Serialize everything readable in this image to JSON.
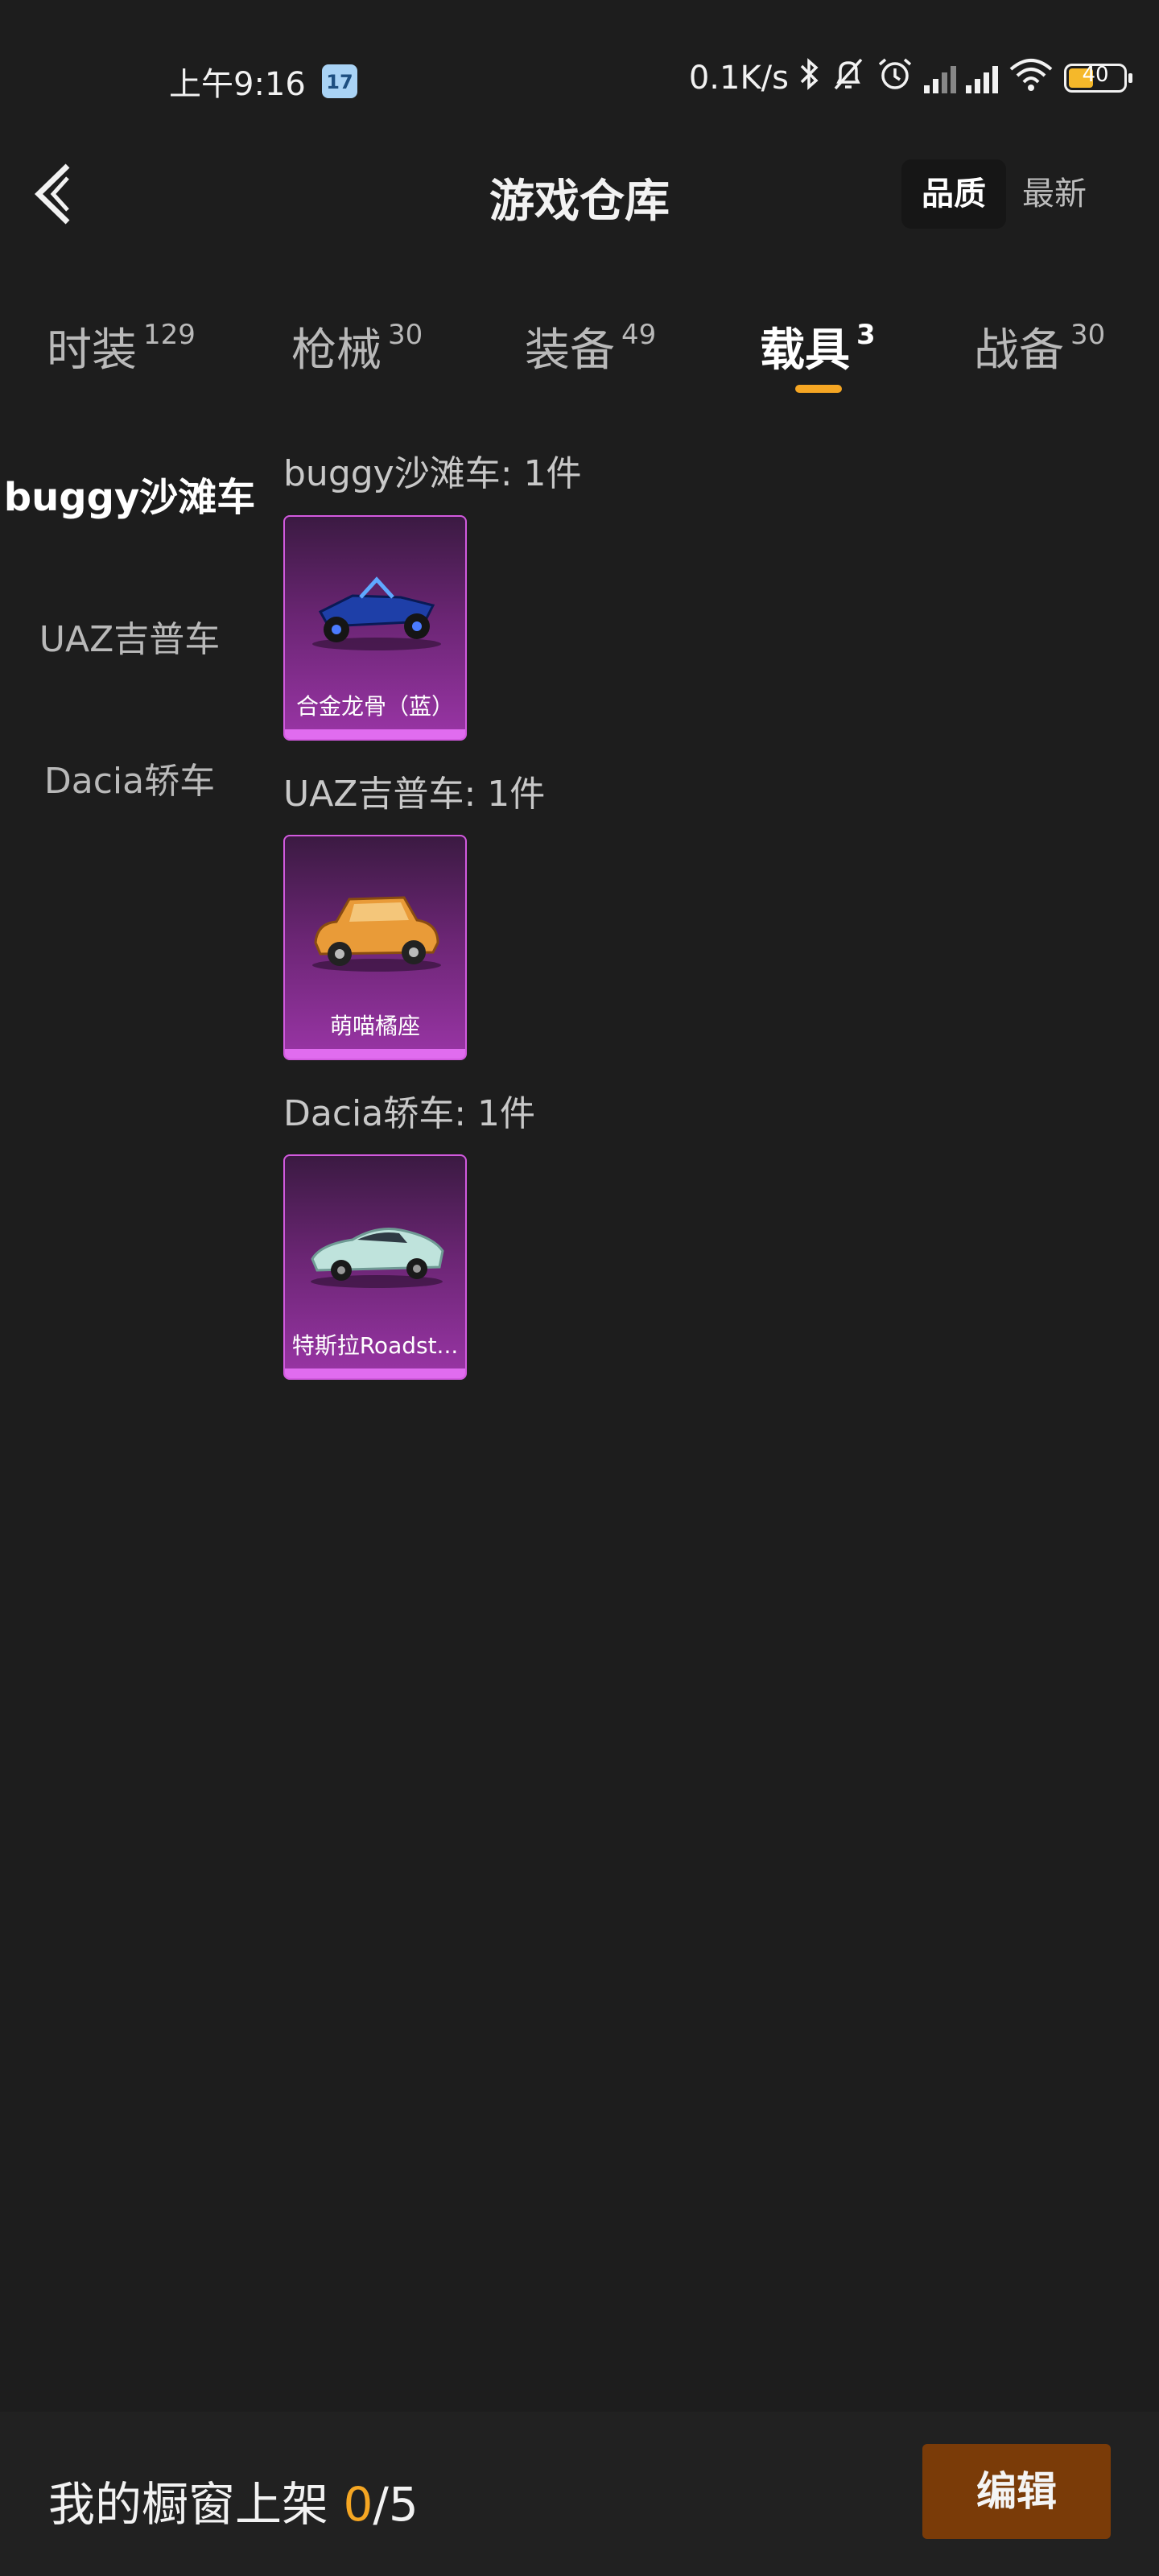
{
  "status_bar": {
    "time": "上午9:16",
    "calendar_day": "17",
    "net_speed": "0.1K/s",
    "battery": "40",
    "icons": [
      "calendar-icon",
      "bluetooth-icon",
      "mute-icon",
      "alarm-icon",
      "hd-signal-icon",
      "signal-icon",
      "wifi-icon",
      "battery-icon"
    ]
  },
  "header": {
    "title": "游戏仓库",
    "sort_quality": "品质",
    "sort_latest": "最新"
  },
  "tabs": [
    {
      "label": "时装",
      "count": "129"
    },
    {
      "label": "枪械",
      "count": "30"
    },
    {
      "label": "装备",
      "count": "49"
    },
    {
      "label": "载具",
      "count": "3",
      "active": true
    },
    {
      "label": "战备",
      "count": "30"
    }
  ],
  "sidebar": {
    "items": [
      {
        "label": "buggy沙滩车",
        "active": true
      },
      {
        "label": "UAZ吉普车"
      },
      {
        "label": "Dacia轿车"
      }
    ]
  },
  "groups": [
    {
      "title": "buggy沙滩车: 1件",
      "items": [
        {
          "name": "合金龙骨（蓝）"
        }
      ]
    },
    {
      "title": "UAZ吉普车: 1件",
      "items": [
        {
          "name": "萌喵橘座"
        }
      ]
    },
    {
      "title": "Dacia轿车: 1件",
      "items": [
        {
          "name": "特斯拉Roadst..."
        }
      ]
    }
  ],
  "footer": {
    "showcase_label": "我的橱窗上架",
    "showcase_used": "0",
    "showcase_total": "/5",
    "edit_label": "编辑"
  },
  "colors": {
    "background": "#1d1d1d",
    "accent": "#f5a623",
    "edit_button": "#7a3b08",
    "card_border": "#d25adf"
  }
}
